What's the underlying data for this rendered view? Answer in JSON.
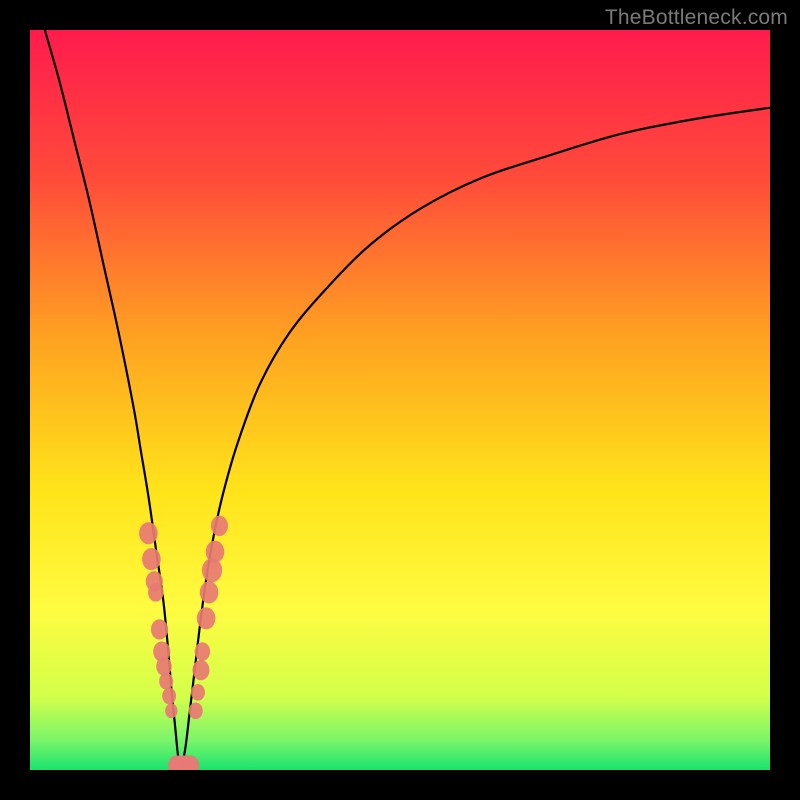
{
  "watermark": "TheBottleneck.com",
  "chart_data": {
    "type": "line",
    "title": "",
    "xlabel": "",
    "ylabel": "",
    "xlim": [
      0,
      100
    ],
    "ylim": [
      0,
      100
    ],
    "grid": false,
    "legend_position": "none",
    "gradient_stops": [
      {
        "offset": 0.0,
        "color": "#ff1b4d"
      },
      {
        "offset": 0.2,
        "color": "#ff4b3a"
      },
      {
        "offset": 0.42,
        "color": "#ffa321"
      },
      {
        "offset": 0.62,
        "color": "#ffe31a"
      },
      {
        "offset": 0.78,
        "color": "#fffb40"
      },
      {
        "offset": 0.9,
        "color": "#d4ff4a"
      },
      {
        "offset": 0.96,
        "color": "#7af56a"
      },
      {
        "offset": 1.0,
        "color": "#19e36e"
      }
    ],
    "series": [
      {
        "name": "left-branch",
        "x": [
          2,
          4,
          6,
          8,
          10,
          12,
          14,
          15,
          16,
          17,
          18,
          18.6,
          19.1,
          19.6,
          20.0,
          20.4
        ],
        "y": [
          100,
          93,
          85,
          77,
          68,
          59,
          49,
          43,
          37,
          30,
          23,
          17,
          11,
          6,
          2,
          0
        ]
      },
      {
        "name": "right-branch",
        "x": [
          20.4,
          21.0,
          21.6,
          22.2,
          22.9,
          23.7,
          24.7,
          26,
          28,
          31,
          35,
          40,
          46,
          53,
          61,
          70,
          80,
          90,
          100
        ],
        "y": [
          0,
          3,
          8,
          13,
          19,
          25,
          31,
          37,
          44,
          52,
          59,
          65,
          71,
          76,
          80,
          83,
          86,
          88,
          89.5
        ]
      }
    ],
    "markers": [
      {
        "x": 16.0,
        "y": 32.0,
        "r": 1.2
      },
      {
        "x": 16.4,
        "y": 28.5,
        "r": 1.2
      },
      {
        "x": 16.8,
        "y": 25.5,
        "r": 1.1
      },
      {
        "x": 17.0,
        "y": 24.0,
        "r": 1.0
      },
      {
        "x": 17.5,
        "y": 19.0,
        "r": 1.1
      },
      {
        "x": 17.8,
        "y": 16.0,
        "r": 1.1
      },
      {
        "x": 18.1,
        "y": 14.0,
        "r": 1.0
      },
      {
        "x": 18.4,
        "y": 12.0,
        "r": 0.9
      },
      {
        "x": 18.8,
        "y": 10.0,
        "r": 0.9
      },
      {
        "x": 19.1,
        "y": 8.0,
        "r": 0.8
      },
      {
        "x": 19.8,
        "y": 0.6,
        "r": 1.1
      },
      {
        "x": 20.2,
        "y": 0.6,
        "r": 1.1
      },
      {
        "x": 20.7,
        "y": 0.6,
        "r": 1.1
      },
      {
        "x": 21.2,
        "y": 0.6,
        "r": 1.1
      },
      {
        "x": 21.7,
        "y": 0.6,
        "r": 1.1
      },
      {
        "x": 22.4,
        "y": 8.0,
        "r": 0.9
      },
      {
        "x": 22.7,
        "y": 10.5,
        "r": 0.9
      },
      {
        "x": 23.1,
        "y": 13.5,
        "r": 1.1
      },
      {
        "x": 23.3,
        "y": 16.0,
        "r": 1.0
      },
      {
        "x": 23.8,
        "y": 20.5,
        "r": 1.2
      },
      {
        "x": 24.2,
        "y": 24.0,
        "r": 1.2
      },
      {
        "x": 24.6,
        "y": 27.0,
        "r": 1.3
      },
      {
        "x": 25.0,
        "y": 29.5,
        "r": 1.2
      },
      {
        "x": 25.6,
        "y": 33.0,
        "r": 1.1
      }
    ]
  }
}
